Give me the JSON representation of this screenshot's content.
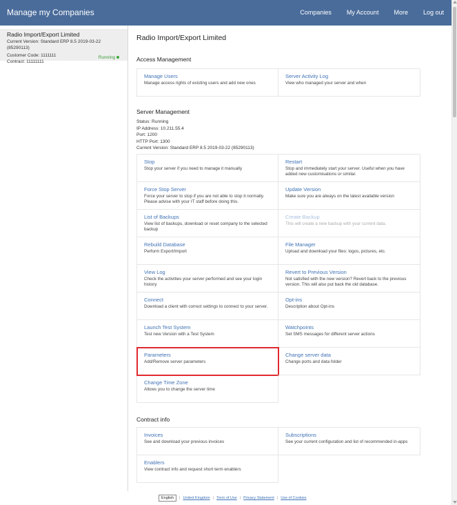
{
  "header": {
    "title": "Manage my Companies",
    "nav": [
      "Companies",
      "My Account",
      "More",
      "Log out"
    ]
  },
  "sidebar": {
    "company_name": "Radio Import/Export Limited",
    "version": "Current Version: Standard ERP 8.5 2019-03-22 (85290113)",
    "customer_code": "Customer Code: 1111111",
    "contract": "Contract: 11111111",
    "status": "Running"
  },
  "main": {
    "page_title": "Radio Import/Export Limited",
    "access": {
      "title": "Access Management",
      "items": [
        {
          "title": "Manage Users",
          "desc": "Manage access rights of existing users and add new ones"
        },
        {
          "title": "Server Activity Log",
          "desc": "View who managed your server and when"
        }
      ]
    },
    "server": {
      "title": "Server Management",
      "status_lines": [
        "Status: Running",
        "IP Address: 10.211.55.4",
        "Port: 1200",
        "HTTP Port: 1300",
        "Current Version: Standard ERP 8.5 2019-03-22 (85290113)"
      ],
      "items": [
        {
          "title": "Stop",
          "desc": "Stop your server if you need to manage it manually"
        },
        {
          "title": "Restart",
          "desc": "Stop and immediately start your server. Useful when you have added new customisations or similar."
        },
        {
          "title": "Force Stop Server",
          "desc": "Force your server to stop if you are not able to stop it normally. Please advise with your IT staff before doing this."
        },
        {
          "title": "Update Version",
          "desc": "Make sure you are always on the latest available version"
        },
        {
          "title": "List of Backups",
          "desc": "View list of backups, download or reset company to the selected backup"
        },
        {
          "title": "Create Backup",
          "desc": "This will create a new backup with your current data."
        },
        {
          "title": "Rebuild Database",
          "desc": "Perform Export/Import"
        },
        {
          "title": "File Manager",
          "desc": "Upload and download your files: logos, pictures, etc."
        },
        {
          "title": "View Log",
          "desc": "Check the activities your server performed and see your login history"
        },
        {
          "title": "Revert to Previous Version",
          "desc": "Not satisfied with the new version? Revert back to the previous version. This will also put back the old database."
        },
        {
          "title": "Connect",
          "desc": "Download a client with correct settings to connect to your server."
        },
        {
          "title": "Opt-ins",
          "desc": "Description about Opt-ins"
        },
        {
          "title": "Launch Test System",
          "desc": "Test new Version with a Test System"
        },
        {
          "title": "Watchpoints",
          "desc": "Set SMS messages for different server actions"
        },
        {
          "title": "Parameters",
          "desc": "Add/Remove server parameters"
        },
        {
          "title": "Change server data",
          "desc": "Change ports and data folder"
        },
        {
          "title": "Change Time Zone",
          "desc": "Allows you to change the server time"
        }
      ]
    },
    "contract": {
      "title": "Contract info",
      "items": [
        {
          "title": "Invoices",
          "desc": "See and download your previous invoices"
        },
        {
          "title": "Subscriptions",
          "desc": "See your current configuration and list of recommended in-apps"
        },
        {
          "title": "Enablers",
          "desc": "View contract info and request short term enablers"
        }
      ]
    }
  },
  "footer": {
    "language": "English",
    "links": [
      "United Kingdom",
      "Term of Use",
      "Privacy Statement",
      "Use of Cookies"
    ]
  },
  "colors": {
    "header_bg": "#4a6c9b",
    "link": "#3f72b5",
    "highlight": "#e0282d",
    "running": "#3a9a3a"
  }
}
